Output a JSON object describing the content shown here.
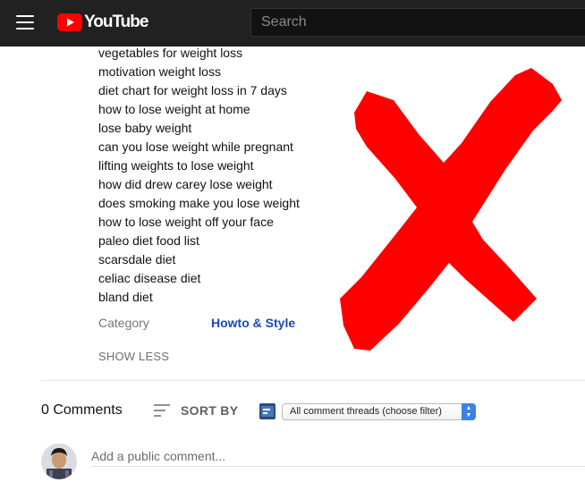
{
  "header": {
    "brand": "YouTube",
    "search_placeholder": "Search",
    "icons": [
      "menu-icon",
      "youtube-logo-icon"
    ]
  },
  "tags": [
    "vegetables for weight loss",
    "motivation weight loss",
    "diet chart for weight loss in 7 days",
    "how to lose weight at home",
    "lose baby weight",
    "can you lose weight while pregnant",
    "lifting weights to lose weight",
    "how did drew carey lose weight",
    "does smoking make you lose weight",
    "how to lose weight off your face",
    "paleo diet food list",
    "scarsdale diet",
    "celiac disease diet",
    "bland diet"
  ],
  "meta": {
    "category_label": "Category",
    "category_value": "Howto & Style",
    "show_less": "SHOW LESS"
  },
  "comments": {
    "count_label": "0 Comments",
    "sort_label": "SORT BY",
    "filter_value": "All comment threads (choose filter)",
    "add_placeholder": "Add a public comment..."
  },
  "colors": {
    "masthead": "#212121",
    "brand_red": "#ff0000",
    "link_blue": "#1a49b5",
    "overlay_x": "#ff0000"
  }
}
